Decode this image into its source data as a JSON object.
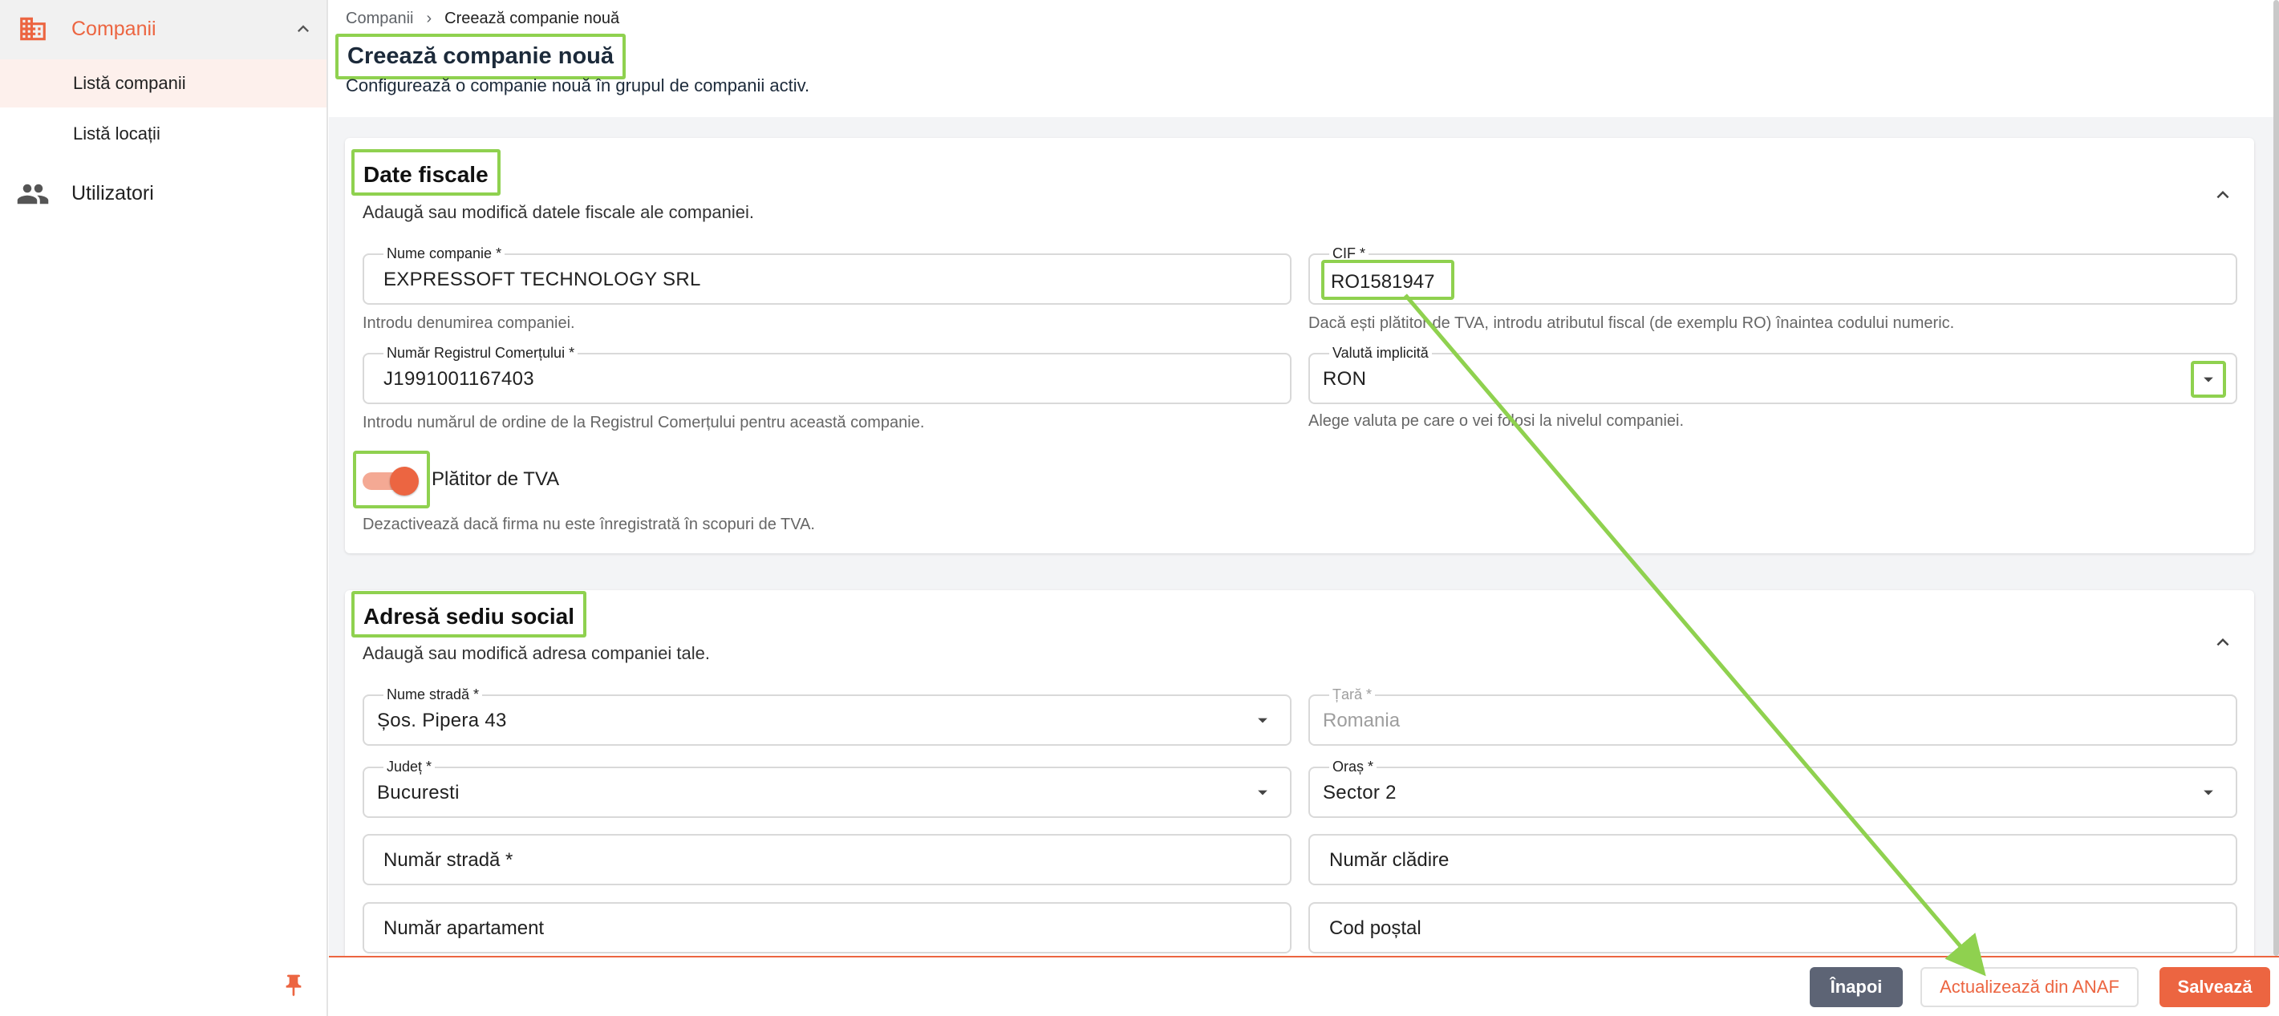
{
  "sidebar": {
    "group_label": "Companii",
    "items": [
      {
        "label": "Listă companii",
        "active": true
      },
      {
        "label": "Listă locații",
        "active": false
      }
    ],
    "users_label": "Utilizatori"
  },
  "breadcrumb": {
    "parent": "Companii",
    "separator": "›",
    "current": "Creează companie nouă"
  },
  "page": {
    "title": "Creează companie nouă",
    "subtitle": "Configurează o companie nouă în grupul de companii activ."
  },
  "fiscal": {
    "title": "Date fiscale",
    "description": "Adaugă sau modifică datele fiscale ale companiei.",
    "company_name": {
      "label": "Nume companie *",
      "value": "EXPRESSOFT TECHNOLOGY SRL",
      "hint": "Introdu denumirea companiei."
    },
    "cif": {
      "label": "CIF *",
      "value": "RO1581947",
      "hint": "Dacă ești plătitor de TVA, introdu atributul fiscal (de exemplu RO) înaintea codului numeric."
    },
    "reg_number": {
      "label": "Număr Registrul Comerțului *",
      "value": "J1991001167403",
      "hint": "Introdu numărul de ordine de la Registrul Comerțului pentru această companie."
    },
    "currency": {
      "label": "Valută implicită",
      "value": "RON",
      "hint": "Alege valuta pe care o vei folosi la nivelul companiei."
    },
    "vat": {
      "label": "Plătitor de TVA",
      "enabled": true,
      "hint": "Dezactivează dacă firma nu este înregistrată în scopuri de TVA."
    }
  },
  "address": {
    "title": "Adresă sediu social",
    "description": "Adaugă sau modifică adresa companiei tale.",
    "street": {
      "label": "Nume stradă *",
      "value": "Șos. Pipera 43"
    },
    "country": {
      "label": "Țară *",
      "value": "Romania"
    },
    "county": {
      "label": "Județ *",
      "value": "Bucuresti"
    },
    "city": {
      "label": "Oraș *",
      "value": "Sector 2"
    },
    "street_number": {
      "placeholder": "Număr stradă *"
    },
    "building_number": {
      "placeholder": "Număr clădire"
    },
    "apartment_number": {
      "placeholder": "Număr apartament"
    },
    "postal_code": {
      "placeholder": "Cod poștal"
    }
  },
  "footer": {
    "back_label": "Înapoi",
    "anaf_label": "Actualizează din ANAF",
    "save_label": "Salvează"
  },
  "colors": {
    "accent": "#ec6541",
    "highlight": "#8fd14f",
    "back_button": "#5d6475"
  },
  "icons": [
    "building-icon",
    "chevron-up-icon",
    "users-icon",
    "pin-icon",
    "chevron-down-icon",
    "dropdown-arrow-icon"
  ]
}
